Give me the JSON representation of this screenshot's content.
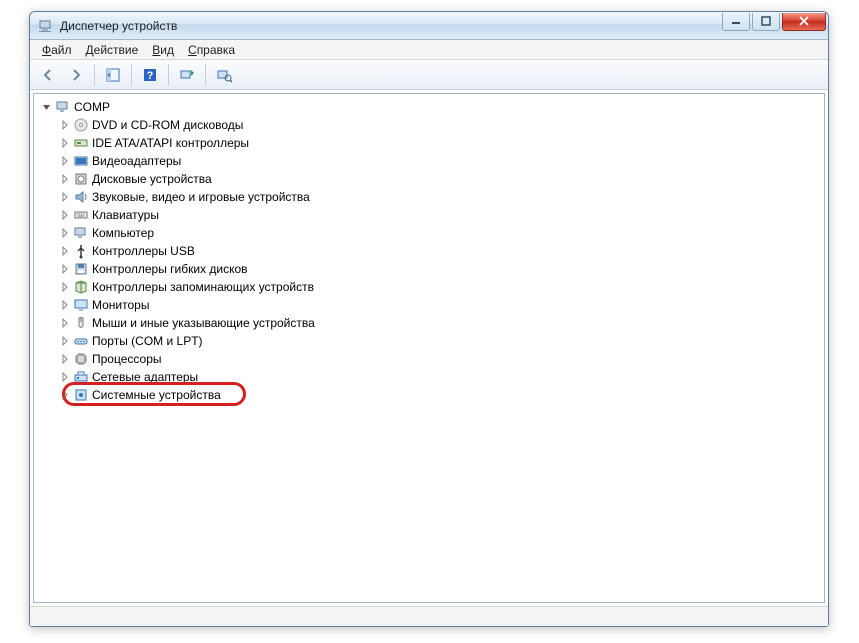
{
  "window": {
    "title": "Диспетчер устройств"
  },
  "menu": {
    "file": "Файл",
    "action": "Действие",
    "view": "Вид",
    "help": "Справка"
  },
  "tree": {
    "root": "COMP",
    "items": [
      {
        "icon": "disc",
        "label": "DVD и CD-ROM дисководы"
      },
      {
        "icon": "ide",
        "label": "IDE ATA/ATAPI контроллеры"
      },
      {
        "icon": "video",
        "label": "Видеоадаптеры"
      },
      {
        "icon": "disk",
        "label": "Дисковые устройства"
      },
      {
        "icon": "audio",
        "label": "Звуковые, видео и игровые устройства"
      },
      {
        "icon": "keyboard",
        "label": "Клавиатуры"
      },
      {
        "icon": "computer",
        "label": "Компьютер"
      },
      {
        "icon": "usb",
        "label": "Контроллеры USB"
      },
      {
        "icon": "floppy",
        "label": "Контроллеры гибких дисков"
      },
      {
        "icon": "storage",
        "label": "Контроллеры запоминающих устройств"
      },
      {
        "icon": "monitor",
        "label": "Мониторы"
      },
      {
        "icon": "mouse",
        "label": "Мыши и иные указывающие устройства"
      },
      {
        "icon": "port",
        "label": "Порты (COM и LPT)"
      },
      {
        "icon": "cpu",
        "label": "Процессоры"
      },
      {
        "icon": "network",
        "label": "Сетевые адаптеры"
      },
      {
        "icon": "system",
        "label": "Системные устройства"
      }
    ]
  },
  "highlight_index": 14
}
